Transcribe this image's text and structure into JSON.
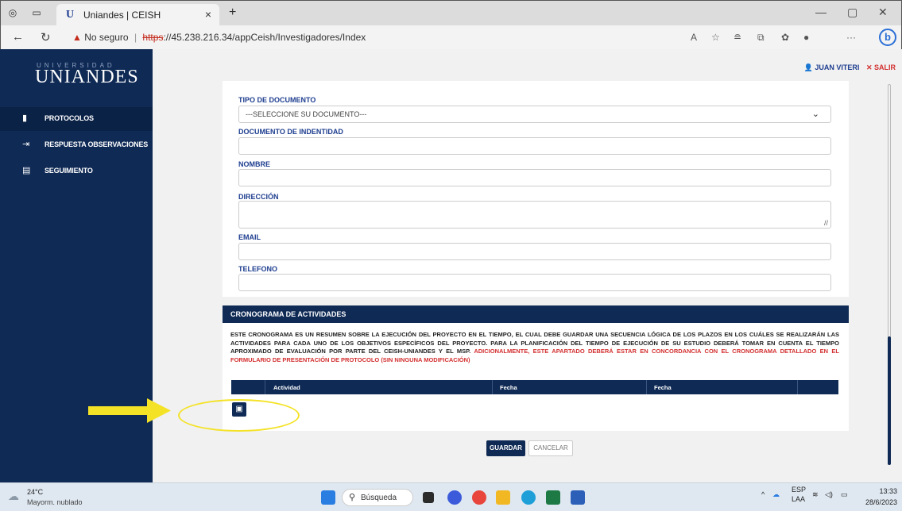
{
  "browser": {
    "tab_title": "Uniandes | CEISH",
    "favicon_letter": "U",
    "new_tab": "+",
    "security_label": "No seguro",
    "url_scheme": "https",
    "url_rest": "://45.238.216.34/appCeish/Investigadores/Index"
  },
  "sidebar": {
    "brand_small": "UNIVERSIDAD",
    "brand": "UNIANDES",
    "items": [
      {
        "label": "PROTOCOLOS",
        "icon": "pdf-file-icon"
      },
      {
        "label": "RESPUESTA OBSERVACIONES",
        "icon": "file-import-icon"
      },
      {
        "label": "SEGUIMIENTO",
        "icon": "document-icon"
      }
    ]
  },
  "header": {
    "user_name": "JUAN VITERI",
    "logout_label": "SALIR"
  },
  "form": {
    "tipo_documento_label": "TIPO DE DOCUMENTO",
    "tipo_documento_value": "---SELECCIONE SU DOCUMENTO---",
    "documento_label": "DOCUMENTO DE INDENTIDAD",
    "nombre_label": "NOMBRE",
    "direccion_label": "DIRECCIÓN",
    "email_label": "EMAIL",
    "telefono_label": "TELEFONO"
  },
  "cronograma": {
    "title": "CRONOGRAMA DE ACTIVIDADES",
    "description": "ESTE CRONOGRAMA ES UN RESUMEN SOBRE LA EJECUCIÓN DEL PROYECTO EN EL TIEMPO, EL CUAL DEBE GUARDAR UNA SECUENCIA LÓGICA DE LOS PLAZOS EN LOS CUÁLES SE REALIZARÁN LAS ACTIVIDADES PARA CADA UNO DE LOS OBJETIVOS ESPECÍFICOS DEL PROYECTO. PARA LA PLANIFICACIÓN DEL TIEMPO DE EJECUCIÓN DE SU ESTUDIO DEBERÁ TOMAR EN CUENTA EL TIEMPO APROXIMADO DE EVALUACIÓN POR PARTE DEL CEISH-UNIANDES Y EL MSP.",
    "note": "ADICIONALMENTE, ESTE APARTADO DEBERÁ ESTAR EN CONCORDANCIA CON EL CRONOGRAMA DETALLADO EN EL FORMULARIO DE PRESENTACIÓN DE PROTOCOLO (SIN NINGUNA MODIFICACIÓN)",
    "columns": [
      "Actividad",
      "Fecha",
      "Fecha"
    ]
  },
  "actions": {
    "save_label": "GUARDAR",
    "cancel_label": "CANCELAR"
  },
  "taskbar": {
    "temperature": "24°C",
    "weather": "Mayorm. nublado",
    "search_label": "Búsqueda",
    "lang_top": "ESP",
    "lang_bottom": "LAA",
    "time": "13:33",
    "date": "28/6/2023"
  },
  "annotation_colors": {
    "arrow": "#f4e227",
    "ellipse": "#f4e227"
  }
}
